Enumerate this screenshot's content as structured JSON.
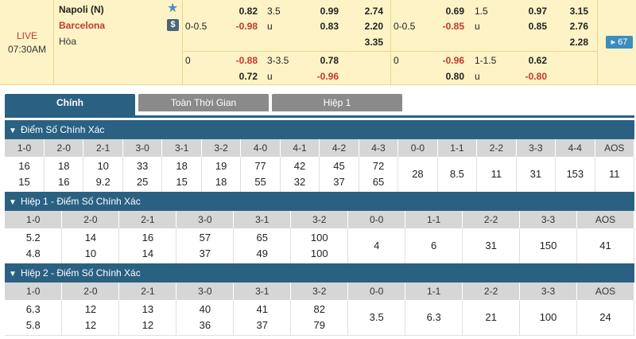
{
  "match": {
    "status": "LIVE",
    "time": "07:30AM",
    "home": "Napoli (N)",
    "away": "Barcelona",
    "draw": "Hòa",
    "more_count": "67",
    "favorite_icon": "star-icon",
    "money_icon": "dollar-icon"
  },
  "odds_full": {
    "row1": {
      "hdp_line": "",
      "home": "0.82",
      "ou_line": "3.5",
      "over": "0.99",
      "x_home": "2.74"
    },
    "row2": {
      "hdp_line": "0-0.5",
      "away": "-0.98",
      "u": "u",
      "under": "0.83",
      "x_away": "2.20"
    },
    "row3": {
      "x_draw": "3.35"
    },
    "row4": {
      "hdp_line": "0",
      "home": "-0.88",
      "ou_line": "3-3.5",
      "over": "0.78"
    },
    "row5": {
      "away": "0.72",
      "u": "u",
      "under": "-0.96"
    }
  },
  "odds_half": {
    "row1": {
      "home": "0.69",
      "ou_line": "1.5",
      "over": "0.97",
      "x_home": "3.15"
    },
    "row2": {
      "hdp_line": "0-0.5",
      "away": "-0.85",
      "u": "u",
      "under": "0.85",
      "x_away": "2.76"
    },
    "row3": {
      "x_draw": "2.28"
    },
    "row4": {
      "hdp_line": "0",
      "home": "-0.96",
      "ou_line": "1-1.5",
      "over": "0.62"
    },
    "row5": {
      "away": "0.80",
      "u": "u",
      "under": "-0.80"
    }
  },
  "tabs": [
    "Chính",
    "Toàn Thời Gian",
    "Hiệp 1"
  ],
  "sections": [
    {
      "title": "Điểm Số Chính Xác",
      "headers": [
        "1-0",
        "2-0",
        "2-1",
        "3-0",
        "3-1",
        "3-2",
        "4-0",
        "4-1",
        "4-2",
        "4-3",
        "0-0",
        "1-1",
        "2-2",
        "3-3",
        "4-4",
        "AOS"
      ],
      "top": [
        "16",
        "18",
        "10",
        "33",
        "18",
        "19",
        "77",
        "42",
        "45",
        "72",
        "28",
        "8.5",
        "11",
        "31",
        "153",
        "11"
      ],
      "bottom": [
        "15",
        "16",
        "9.2",
        "25",
        "15",
        "18",
        "55",
        "32",
        "37",
        "65",
        "",
        "",
        "",
        "",
        "",
        ""
      ]
    },
    {
      "title": "Hiệp 1 - Điểm Số Chính Xác",
      "headers": [
        "1-0",
        "2-0",
        "2-1",
        "3-0",
        "3-1",
        "3-2",
        "0-0",
        "1-1",
        "2-2",
        "3-3",
        "AOS"
      ],
      "top": [
        "5.2",
        "14",
        "16",
        "57",
        "65",
        "100",
        "4",
        "6",
        "31",
        "150",
        "41"
      ],
      "bottom": [
        "4.8",
        "10",
        "14",
        "37",
        "49",
        "100",
        "",
        "",
        "",
        "",
        ""
      ]
    },
    {
      "title": "Hiệp 2 - Điểm Số Chính Xác",
      "headers": [
        "1-0",
        "2-0",
        "2-1",
        "3-0",
        "3-1",
        "3-2",
        "0-0",
        "1-1",
        "2-2",
        "3-3",
        "AOS"
      ],
      "top": [
        "6.3",
        "12",
        "13",
        "40",
        "41",
        "82",
        "3.5",
        "6.3",
        "21",
        "100",
        "24"
      ],
      "bottom": [
        "5.8",
        "12",
        "12",
        "36",
        "37",
        "79",
        "",
        "",
        "",
        "",
        ""
      ]
    }
  ]
}
